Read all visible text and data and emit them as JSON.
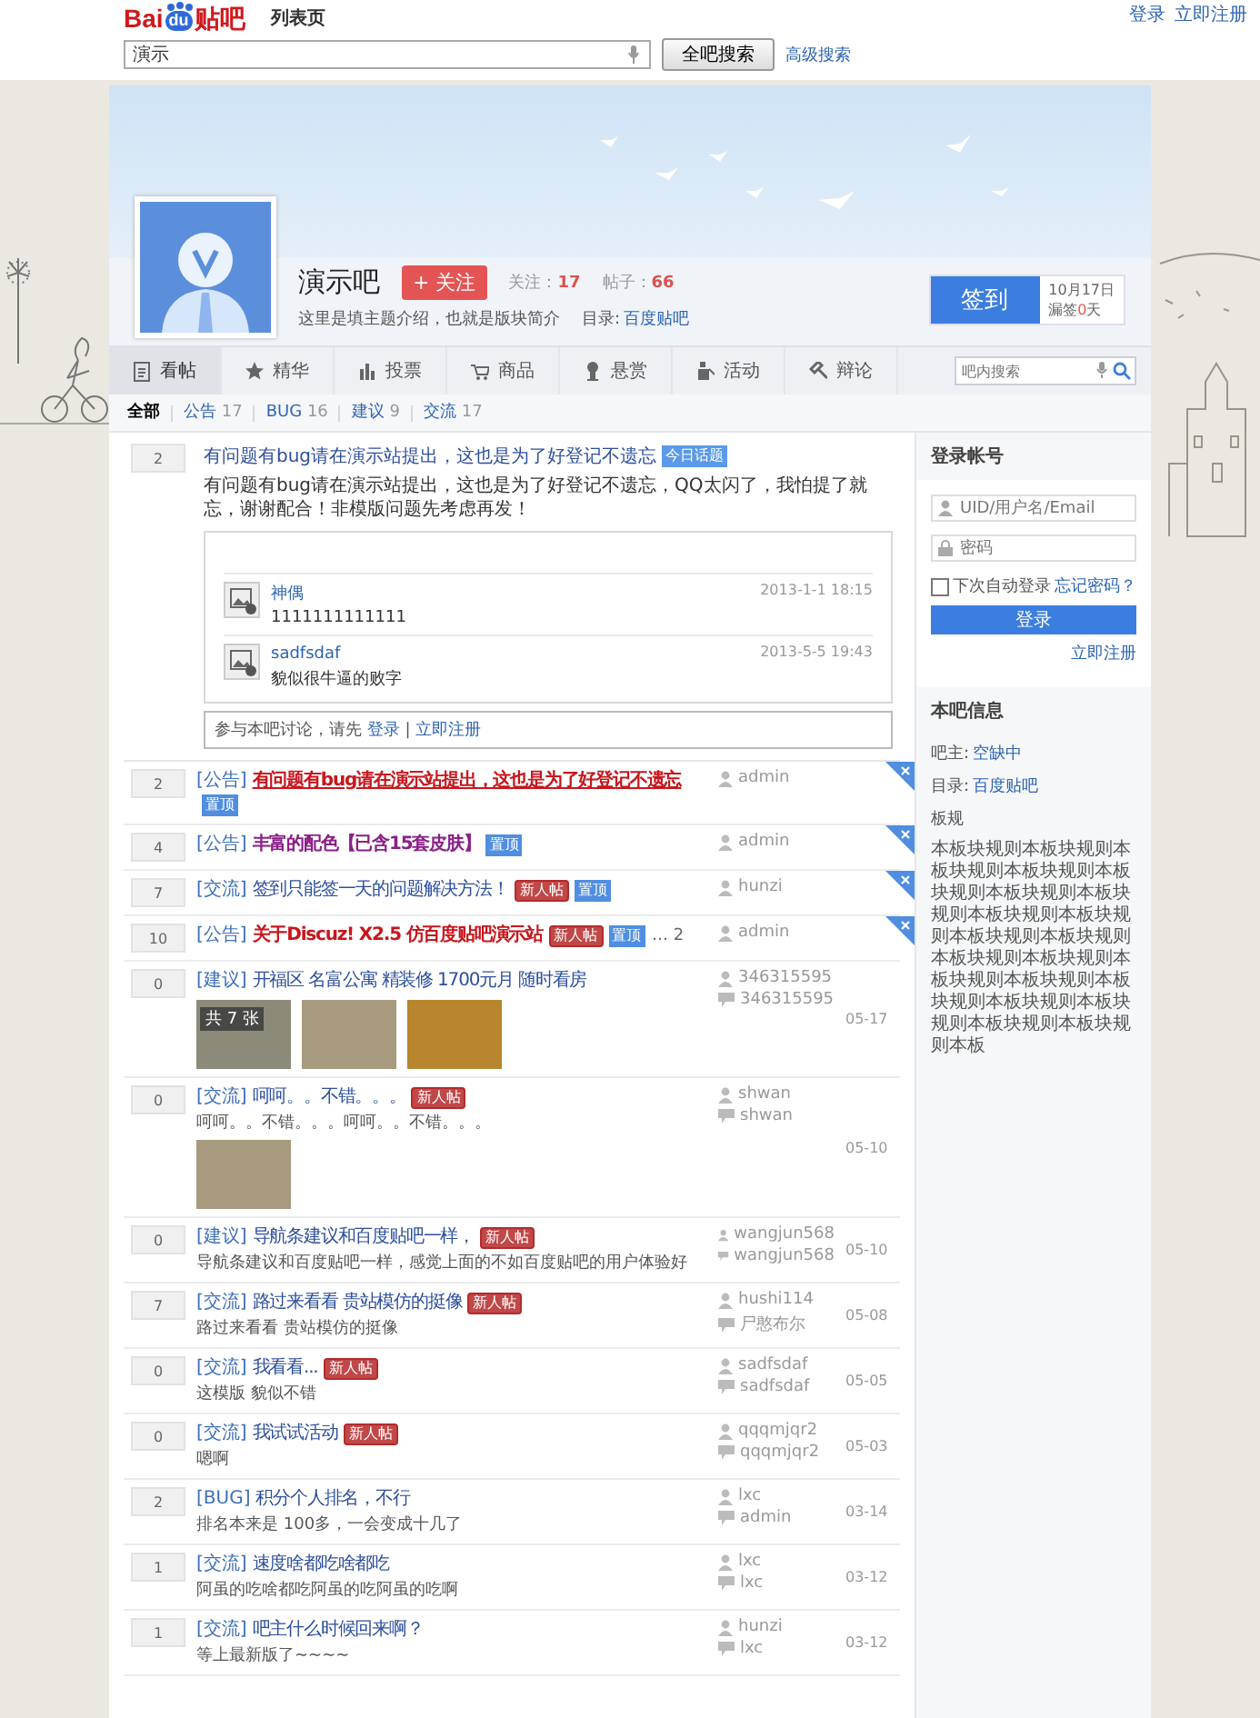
{
  "top_links": [
    "登录",
    "立即注册"
  ],
  "header": {
    "logo": {
      "text_1": "Bai",
      "paw": "du",
      "text_2": "贴吧"
    },
    "page_label": "列表页",
    "search": {
      "value": "演示"
    },
    "search_button": "全吧搜索",
    "advanced_link": "高级搜索"
  },
  "forum": {
    "name": "演示吧",
    "follow_button": "+ 关注",
    "follow_label": "关注：",
    "follow_count": "17",
    "post_label": "帖子：",
    "post_count": "66",
    "intro": "这里是填主题介绍，也就是版块简介",
    "category_label": "目录:",
    "category": "百度贴吧",
    "sign_button": "签到",
    "sign_date": "10月17日",
    "missed_label": "漏签",
    "missed_count": "0",
    "missed_unit": "天"
  },
  "nav": {
    "tabs": [
      {
        "label": "看帖",
        "selected": true
      },
      {
        "label": "精华",
        "selected": false
      },
      {
        "label": "投票",
        "selected": false
      },
      {
        "label": "商品",
        "selected": false
      },
      {
        "label": "悬赏",
        "selected": false
      },
      {
        "label": "活动",
        "selected": false
      },
      {
        "label": "辩论",
        "selected": false
      }
    ],
    "search": {
      "placeholder": "吧内搜索"
    }
  },
  "filters": [
    {
      "label": "全部",
      "selected": true
    },
    {
      "label": "公告",
      "count": "17",
      "selected": false
    },
    {
      "label": "BUG",
      "count": "16",
      "selected": false
    },
    {
      "label": "建议",
      "count": "9",
      "selected": false
    },
    {
      "label": "交流",
      "count": "17",
      "selected": false
    }
  ],
  "featured": {
    "replies": "2",
    "title": "有问题有bug请在演示站提出，这也是为了好登记不遗忘",
    "badge": "今日话题",
    "body": "有问题有bug请在演示站提出，这也是为了好登记不遗忘，QQ太闪了，我怕提了就忘，谢谢配合！非模版问题先考虑再发！",
    "comments": [
      {
        "user": "神偶",
        "text": "1111111111111",
        "time": "2013-1-1 18:15"
      },
      {
        "user": "sadfsdaf",
        "text": "貌似很牛逼的败字",
        "time": "2013-5-5 19:43"
      }
    ],
    "prompt": "参与本吧讨论，请先",
    "login_link": "登录",
    "separator": "|",
    "register_link": "立即注册"
  },
  "threads": [
    {
      "replies": "2",
      "tag": "[公告]",
      "title": "有问题有bug请在演示站提出，这也是为了好登记不遗忘",
      "kind": "notice",
      "badges": [
        {
          "kind": "top",
          "label": "置顶"
        }
      ],
      "author": "admin",
      "pinned": true
    },
    {
      "replies": "4",
      "tag": "[公告]",
      "title": "丰富的配色【已含15套皮肤】",
      "kind": "featured",
      "badges": [
        {
          "kind": "top",
          "label": "置顶"
        }
      ],
      "author": "admin",
      "pinned": true
    },
    {
      "replies": "7",
      "tag": "[交流]",
      "title": "签到只能签一天的问题解决方法！",
      "kind": "normal",
      "badges": [
        {
          "kind": "new",
          "label": "新人帖"
        },
        {
          "kind": "top",
          "label": "置顶"
        }
      ],
      "author": "hunzi",
      "pinned": true
    },
    {
      "replies": "10",
      "tag": "[公告]",
      "title": "关于Discuz! X2.5 仿百度贴吧演示站",
      "kind": "highlight",
      "badges": [
        {
          "kind": "new",
          "label": "新人帖"
        },
        {
          "kind": "top",
          "label": "置顶"
        }
      ],
      "pages": "… 2",
      "author": "admin",
      "pinned": true
    },
    {
      "replies": "0",
      "tag": "[建议]",
      "title": "开福区 名富公寓 精装修 1700元月 随时看房",
      "kind": "normal",
      "photos": [
        {
          "kind": "photo",
          "overlay": "共 7 张"
        },
        {
          "kind": "photo"
        },
        {
          "kind": "photo"
        }
      ],
      "author": "346315595",
      "last_reply": "346315595",
      "date": "05-17",
      "pinned": false
    },
    {
      "replies": "0",
      "tag": "[交流]",
      "title": "呵呵。。不错。。。",
      "kind": "normal",
      "badges": [
        {
          "kind": "new",
          "label": "新人帖"
        }
      ],
      "excerpt": "呵呵。。不错。。。呵呵。。不错。。。",
      "photos": [
        {
          "kind": "photo"
        }
      ],
      "author": "shwan",
      "last_reply": "shwan",
      "date": "05-10",
      "pinned": false
    },
    {
      "replies": "0",
      "tag": "[建议]",
      "title": "导航条建议和百度贴吧一样，",
      "kind": "normal",
      "badges": [
        {
          "kind": "new",
          "label": "新人帖"
        }
      ],
      "excerpt": "导航条建议和百度贴吧一样，感觉上面的不如百度贴吧的用户体验好",
      "author": "wangjun568",
      "last_reply": "wangjun568",
      "date": "05-10",
      "pinned": false
    },
    {
      "replies": "7",
      "tag": "[交流]",
      "title": "路过来看看 贵站模仿的挺像",
      "kind": "normal",
      "badges": [
        {
          "kind": "new",
          "label": "新人帖"
        }
      ],
      "excerpt": "路过来看看 贵站模仿的挺像",
      "author": "hushi114",
      "last_reply": "尸憨布尔",
      "date": "05-08",
      "pinned": false
    },
    {
      "replies": "0",
      "tag": "[交流]",
      "title": "我看看...",
      "kind": "normal",
      "badges": [
        {
          "kind": "new",
          "label": "新人帖"
        }
      ],
      "excerpt": "这模版 貌似不错",
      "author": "sadfsdaf",
      "last_reply": "sadfsdaf",
      "date": "05-05",
      "pinned": false
    },
    {
      "replies": "0",
      "tag": "[交流]",
      "title": "我试试活动",
      "kind": "normal",
      "badges": [
        {
          "kind": "new",
          "label": "新人帖"
        }
      ],
      "excerpt": "嗯啊",
      "author": "qqqmjqr2",
      "last_reply": "qqqmjqr2",
      "date": "05-03",
      "pinned": false
    },
    {
      "replies": "2",
      "tag": "[BUG]",
      "title": "积分个人排名，不行",
      "kind": "normal",
      "excerpt": "排名本来是 100多，一会变成十几了",
      "author": "lxc",
      "last_reply": "admin",
      "date": "03-14",
      "pinned": false
    },
    {
      "replies": "1",
      "tag": "[交流]",
      "title": "速度啥都吃啥都吃",
      "kind": "normal",
      "excerpt": "阿虽的吃啥都吃阿虽的吃阿虽的吃啊",
      "author": "lxc",
      "last_reply": "lxc",
      "date": "03-12",
      "pinned": false
    },
    {
      "replies": "1",
      "tag": "[交流]",
      "title": "吧主什么时候回来啊？",
      "kind": "normal",
      "excerpt": "等上最新版了~~~~",
      "author": "hunzi",
      "last_reply": "lxc",
      "date": "03-12",
      "pinned": false
    }
  ],
  "sidebar": {
    "login": {
      "title": "登录帐号",
      "username": {
        "placeholder": "UID/用户名/Email"
      },
      "password": {
        "placeholder": "密码"
      },
      "remember": {
        "label": "下次自动登录",
        "checked": false
      },
      "forgot_link": "忘记密码？",
      "login_button": "登录",
      "register_link": "立即注册"
    },
    "info": {
      "title": "本吧信息",
      "owner_label": "吧主:",
      "owner": "空缺中",
      "category_label": "目录:",
      "category": "百度贴吧",
      "rules_title": "板规",
      "rules": "本板块规则本板块规则本板块规则本板块规则本板块规则本板块规则本板块规则本板块规则本板块规则本板块规则本板块规则本板块规则本板块规则本板块规则本板块规则本板块规则本板块规则本板块规则本板块规则本板块规则本板"
    }
  }
}
